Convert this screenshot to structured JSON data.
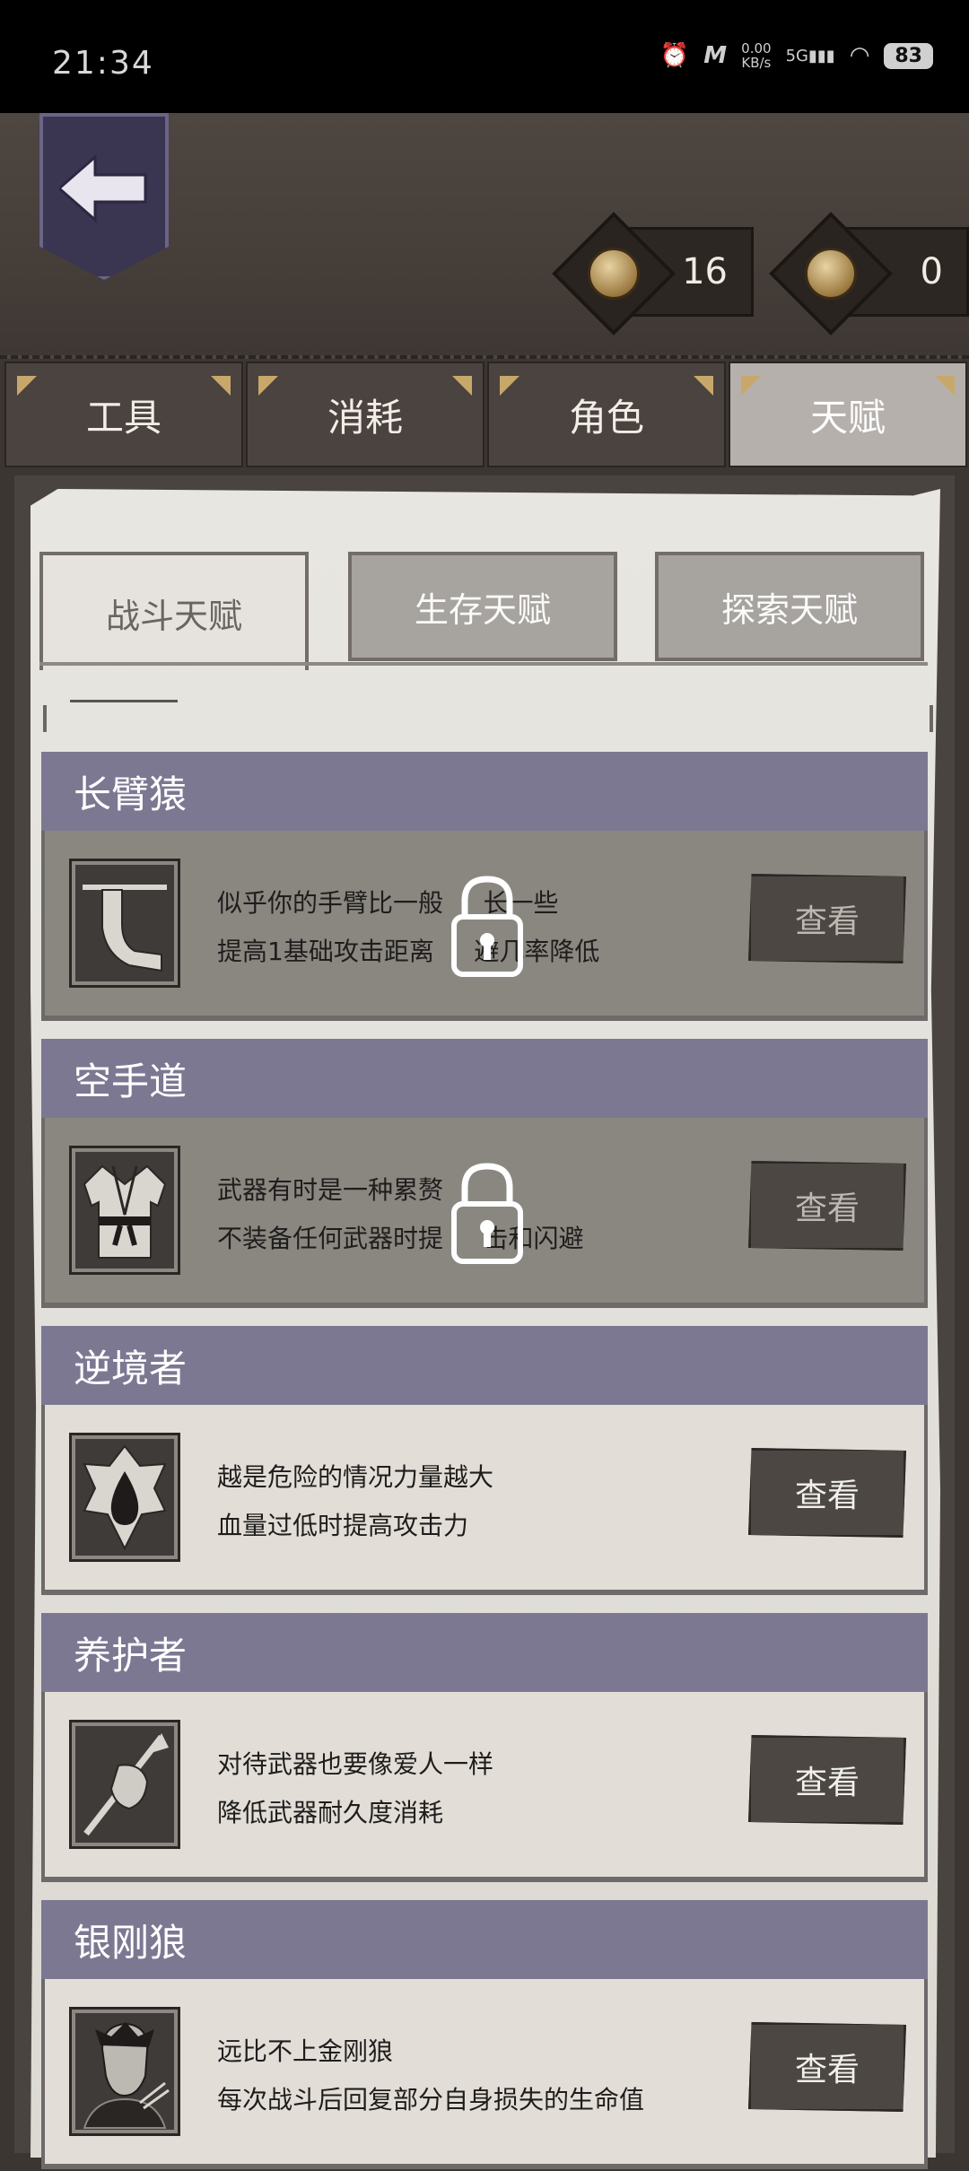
{
  "status_bar": {
    "time": "21:34",
    "network_speed": "0.00",
    "network_unit": "KB/s",
    "signal": "5G",
    "battery": "83"
  },
  "header": {
    "back_icon": "back-arrow-icon",
    "currency": [
      {
        "icon": "coin-icon",
        "value": "16"
      },
      {
        "icon": "coin-icon",
        "value": "0"
      }
    ]
  },
  "tabs": [
    {
      "label": "工具",
      "active": false
    },
    {
      "label": "消耗",
      "active": false
    },
    {
      "label": "角色",
      "active": false
    },
    {
      "label": "天赋",
      "active": true
    }
  ],
  "subtabs": [
    {
      "label": "战斗天赋",
      "active": true
    },
    {
      "label": "生存天赋",
      "active": false
    },
    {
      "label": "探索天赋",
      "active": false
    }
  ],
  "talents": [
    {
      "title": "长臂猿",
      "icon": "long-arm-icon",
      "line1": "似乎你的手臂比一般",
      "line1b": "长一些",
      "line2": "提高1基础攻击距离",
      "line2b": "避几率降低",
      "button": "查看",
      "locked": true
    },
    {
      "title": "空手道",
      "icon": "karate-uniform-icon",
      "line1": "武器有时是一种累赘",
      "line1b": "",
      "line2": "不装备任何武器时提",
      "line2b": "击和闪避",
      "button": "查看",
      "locked": true
    },
    {
      "title": "逆境者",
      "icon": "blood-drop-icon",
      "line1": "越是危险的情况力量越大",
      "line1b": "",
      "line2": "血量过低时提高攻击力",
      "line2b": "",
      "button": "查看",
      "locked": false
    },
    {
      "title": "养护者",
      "icon": "spear-cloth-icon",
      "line1": "对待武器也要像爱人一样",
      "line1b": "",
      "line2": "降低武器耐久度消耗",
      "line2b": "",
      "button": "查看",
      "locked": false
    },
    {
      "title": "银刚狼",
      "icon": "wolverine-portrait-icon",
      "line1": "远比不上金刚狼",
      "line1b": "",
      "line2": "每次战斗后回复部分自身损失的生命值",
      "line2b": "",
      "button": "查看",
      "locked": false
    }
  ]
}
